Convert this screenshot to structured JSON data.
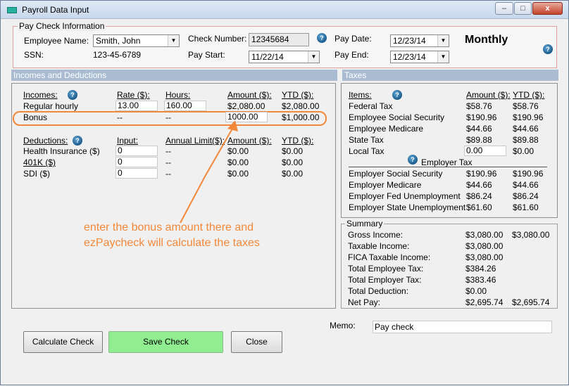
{
  "window": {
    "title": "Payroll Data Input",
    "min_label": "–",
    "max_label": "□",
    "close_label": "x"
  },
  "pay_check": {
    "section_title": "Pay Check Information",
    "employee_name_label": "Employee Name:",
    "employee_name_value": "Smith, John",
    "ssn_label": "SSN:",
    "ssn_value": "123-45-6789",
    "check_number_label": "Check Number:",
    "check_number_value": "12345684",
    "pay_start_label": "Pay Start:",
    "pay_start_value": "11/22/14",
    "pay_date_label": "Pay Date:",
    "pay_date_value": "12/23/14",
    "pay_end_label": "Pay End:",
    "pay_end_value": "12/23/14",
    "frequency": "Monthly"
  },
  "incomes_deductions": {
    "band_title": "Incomes and Deductions",
    "incomes_header": {
      "label": "Incomes:",
      "rate": "Rate ($):",
      "hours": "Hours:",
      "amount": "Amount ($):",
      "ytd": "YTD ($):"
    },
    "incomes": [
      {
        "name": "Regular hourly",
        "rate": "13.00",
        "hours": "160.00",
        "amount": "$2,080.00",
        "ytd": "$2,080.00"
      },
      {
        "name": "Bonus",
        "rate": "--",
        "hours": "--",
        "amount": "1000.00",
        "ytd": "$1,000.00"
      }
    ],
    "deductions_header": {
      "label": "Deductions:",
      "input": "Input:",
      "limit": "Annual Limit($):",
      "amount": "Amount ($):",
      "ytd": "YTD ($):"
    },
    "deductions": [
      {
        "name": "Health Insurance  ($)",
        "input": "0",
        "limit": "--",
        "amount": "$0.00",
        "ytd": "$0.00"
      },
      {
        "name": "401K  ($)",
        "input": "0",
        "limit": "--",
        "amount": "$0.00",
        "ytd": "$0.00"
      },
      {
        "name": "SDI  ($)",
        "input": "0",
        "limit": "--",
        "amount": "$0.00",
        "ytd": "$0.00"
      }
    ],
    "annotation": "enter the bonus amount there and ezPaycheck will calculate the taxes"
  },
  "taxes": {
    "band_title": "Taxes",
    "header": {
      "items": "Items:",
      "amount": "Amount ($):",
      "ytd": "YTD ($):"
    },
    "employee_items": [
      {
        "name": "Federal Tax",
        "amount": "$58.76",
        "ytd": "$58.76"
      },
      {
        "name": "Employee Social Security",
        "amount": "$190.96",
        "ytd": "$190.96"
      },
      {
        "name": "Employee Medicare",
        "amount": "$44.66",
        "ytd": "$44.66"
      },
      {
        "name": "State Tax",
        "amount": "$89.88",
        "ytd": "$89.88"
      },
      {
        "name": "Local Tax",
        "amount": "0.00",
        "ytd": "$0.00"
      }
    ],
    "employer_title": "Employer Tax",
    "employer_items": [
      {
        "name": "Employer Social Security",
        "amount": "$190.96",
        "ytd": "$190.96"
      },
      {
        "name": "Employer Medicare",
        "amount": "$44.66",
        "ytd": "$44.66"
      },
      {
        "name": "Employer Fed Unemployment",
        "amount": "$86.24",
        "ytd": "$86.24"
      },
      {
        "name": "Employer State Unemployment",
        "amount": "$61.60",
        "ytd": "$61.60"
      }
    ]
  },
  "summary": {
    "title": "Summary",
    "rows": [
      {
        "label": "Gross Income:",
        "value": "$3,080.00",
        "ytd": "$3,080.00"
      },
      {
        "label": "Taxable Income:",
        "value": "$3,080.00",
        "ytd": ""
      },
      {
        "label": "FICA Taxable Income:",
        "value": "$3,080.00",
        "ytd": ""
      },
      {
        "label": "Total Employee Tax:",
        "value": "$384.26",
        "ytd": ""
      },
      {
        "label": "Total Employer Tax:",
        "value": "$383.46",
        "ytd": ""
      },
      {
        "label": "Total Deduction:",
        "value": "$0.00",
        "ytd": ""
      },
      {
        "label": "Net Pay:",
        "value": "$2,695.74",
        "ytd": "$2,695.74"
      }
    ]
  },
  "memo": {
    "label": "Memo:",
    "value": "Pay check"
  },
  "buttons": {
    "calculate": "Calculate Check",
    "save": "Save Check",
    "close": "Close"
  },
  "help_glyph": "?",
  "colors": {
    "accent": "#f2883a",
    "save_button": "#90ee90",
    "band": "#a9bcd2"
  }
}
